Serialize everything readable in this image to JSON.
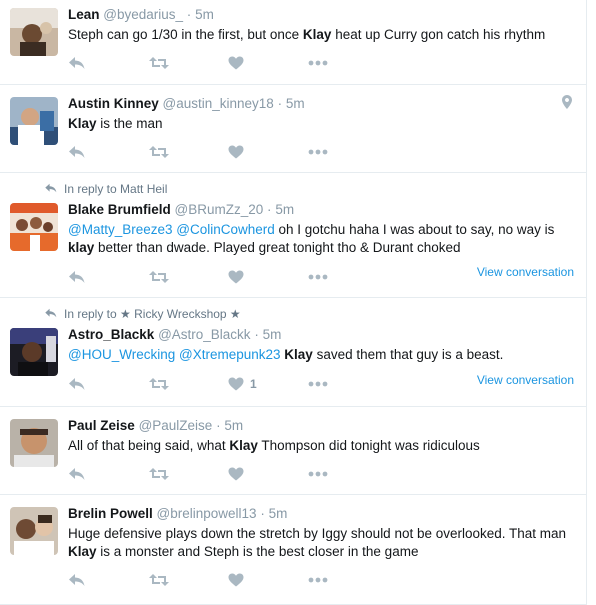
{
  "tweets": [
    {
      "fullname": "Lean",
      "handle": "@byedarius_",
      "time": "5m",
      "text_parts": [
        {
          "t": "Steph can go 1/30 in the first, but once ",
          "s": "plain"
        },
        {
          "t": "Klay",
          "s": "bold"
        },
        {
          "t": " heat up Curry gon catch his rhythm",
          "s": "plain"
        }
      ]
    },
    {
      "fullname": "Austin Kinney",
      "handle": "@austin_kinney18",
      "time": "5m",
      "text_parts": [
        {
          "t": "Klay",
          "s": "bold"
        },
        {
          "t": " is the man",
          "s": "plain"
        }
      ]
    },
    {
      "reply_context": "In reply to Matt Heil",
      "fullname": "Blake Brumfield",
      "handle": "@BRumZz_20",
      "time": "5m",
      "text_parts": [
        {
          "t": "@Matty_Breeze3",
          "s": "mention"
        },
        {
          "t": " ",
          "s": "plain"
        },
        {
          "t": "@ColinCowherd",
          "s": "mention"
        },
        {
          "t": " oh I gotchu haha I was about to say, no way is ",
          "s": "plain"
        },
        {
          "t": "klay",
          "s": "bold"
        },
        {
          "t": " better than dwade. Played great tonight tho & Durant choked",
          "s": "plain"
        }
      ],
      "view_conversation": "View conversation"
    },
    {
      "reply_context": "In reply to ★ Ricky Wreckshop ★",
      "fullname": "Astro_Blackk",
      "handle": "@Astro_Blackk",
      "time": "5m",
      "text_parts": [
        {
          "t": "@HOU_Wrecking",
          "s": "mention"
        },
        {
          "t": " ",
          "s": "plain"
        },
        {
          "t": "@Xtremepunk23",
          "s": "mention"
        },
        {
          "t": "  ",
          "s": "plain"
        },
        {
          "t": "Klay",
          "s": "bold"
        },
        {
          "t": " saved them that guy is a beast.",
          "s": "plain"
        }
      ],
      "like_count": "1",
      "view_conversation": "View conversation"
    },
    {
      "fullname": "Paul Zeise",
      "handle": "@PaulZeise",
      "time": "5m",
      "text_parts": [
        {
          "t": "All of that being said, what ",
          "s": "plain"
        },
        {
          "t": "Klay",
          "s": "bold"
        },
        {
          "t": " Thompson did tonight was ridiculous",
          "s": "plain"
        }
      ]
    },
    {
      "fullname": "Brelin Powell",
      "handle": "@brelinpowell13",
      "time": "5m",
      "text_parts": [
        {
          "t": "Huge defensive plays down the stretch by Iggy should not be overlooked. That man ",
          "s": "plain"
        },
        {
          "t": "Klay",
          "s": "bold"
        },
        {
          "t": " is a monster and Steph is the best closer in the game",
          "s": "plain"
        }
      ]
    }
  ],
  "separator": "·",
  "icons": {
    "reply": "reply-icon",
    "retweet": "retweet-icon",
    "like": "heart-icon",
    "more": "more-icon",
    "reply_context": "reply-context-icon",
    "geo": "location-pin-icon"
  },
  "colors": {
    "link": "#1b95e0",
    "icon": "#aab8c2",
    "meta": "#8899a6",
    "text": "#14171a"
  }
}
